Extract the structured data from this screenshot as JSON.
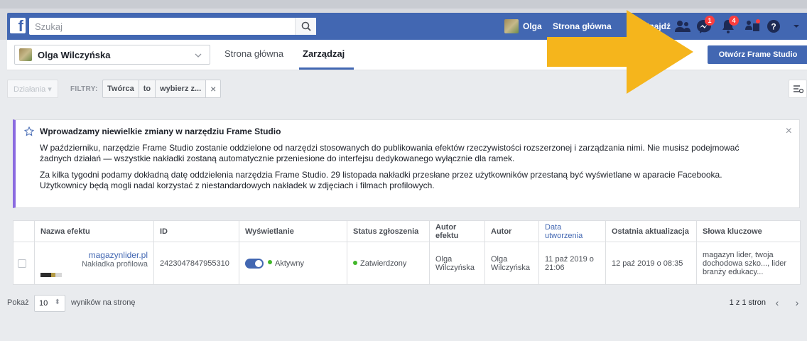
{
  "topbar": {
    "search_placeholder": "Szukaj",
    "profile_name": "Olga",
    "home_label": "Strona główna",
    "find_label": "Znajdź",
    "messages_badge": "1",
    "notifications_badge": "4",
    "requests_badge": ""
  },
  "page_header": {
    "page_name": "Olga Wilczyńska",
    "tabs": [
      {
        "label": "Strona główna"
      },
      {
        "label": "Zarządzaj"
      }
    ],
    "open_studio_label": "Otwórz Frame Studio"
  },
  "filters": {
    "actions_label": "Działania ▾",
    "filters_label": "FILTRY:",
    "chip": {
      "field": "Twórca",
      "op": "to",
      "value": "wybierz z...",
      "remove": "×"
    }
  },
  "notice": {
    "title": "Wprowadzamy niewielkie zmiany w narzędziu Frame Studio",
    "paragraph1": "W październiku, narzędzie Frame Studio zostanie oddzielone od narzędzi stosowanych do publikowania efektów rzeczywistości rozszerzonej i zarządzania nimi. Nie musisz podejmować żadnych działań — wszystkie nakładki zostaną automatycznie przeniesione do interfejsu dedykowanego wyłącznie dla ramek.",
    "paragraph2": "Za kilka tygodni podamy dokładną datę oddzielenia narzędzia Frame Studio. 29 listopada nakładki przesłane przez użytkowników przestaną być wyświetlane w aparacie Facebooka. Użytkownicy będą mogli nadal korzystać z niestandardowych nakładek w zdjęciach i filmach profilowych.",
    "close": "×"
  },
  "table": {
    "headers": [
      "Nazwa efektu",
      "ID",
      "Wyświetlanie",
      "Status zgłoszenia",
      "Autor efektu",
      "Autor",
      "Data utworzenia",
      "Ostatnia aktualizacja",
      "Słowa kluczowe"
    ],
    "rows": [
      {
        "name": "magazynlider.pl",
        "type": "Nakładka profilowa",
        "id": "2423047847955310",
        "display": "Aktywny",
        "status": "Zatwierdzony",
        "effect_author": "Olga Wilczyńska",
        "author": "Olga Wilczyńska",
        "created": "11 paź 2019 o 21:06",
        "updated": "12 paź 2019 o 08:35",
        "keywords": "magazyn lider, twoja dochodowa szko..., lider branży edukacy..."
      }
    ]
  },
  "pagination": {
    "show_label": "Pokaż",
    "per_page": "10",
    "per_page_suffix": "wyników na stronę",
    "pages": "1 z 1 stron",
    "prev": "‹",
    "next": "›"
  },
  "colors": {
    "brand": "#4267b2",
    "arrow": "#f5b51c",
    "notice_accent": "#8b6be0",
    "active": "#42b72a"
  }
}
